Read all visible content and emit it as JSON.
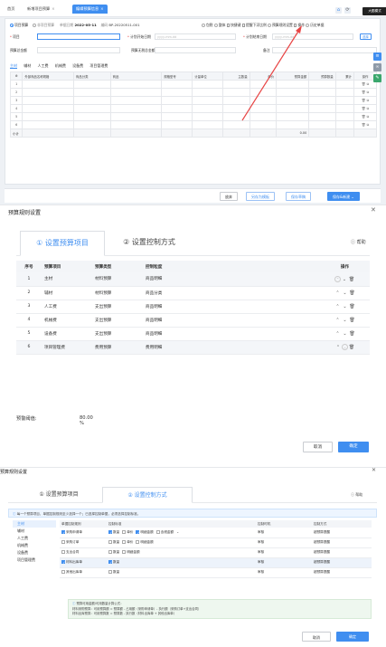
{
  "app": {
    "tabs": [
      {
        "label": "首页",
        "active": false
      },
      {
        "label": "新增项目预算",
        "active": false
      },
      {
        "label": "编辑预算信息",
        "active": true
      }
    ],
    "tooltip": "大图模式",
    "header": {
      "mode_project": "项目预算",
      "mode_nonproject": "非项目预算",
      "date_label": "单据日期",
      "date_value": "2022-05-11",
      "code_label": "编码",
      "code_value": "BP-20220511-001",
      "options": [
        "包税",
        "整体",
        "快捷键",
        "提醒下浮比例",
        "预算规则设置",
        "操作",
        "历史单据"
      ]
    },
    "form": {
      "project_label": "项目",
      "plan_start_label": "计划开始日期",
      "plan_start_placeholder": "yyyy-mm-dd",
      "plan_end_label": "计划结束日期",
      "plan_end_placeholder": "yyyy-mm-dd",
      "select_button": "选择",
      "budget_total_label": "预算总金额",
      "budget_excl_label": "预算无税总金额",
      "remark_label": "备注"
    },
    "subtabs": [
      "主材",
      "辅材",
      "人工费",
      "机械费",
      "设备费",
      "项目管理费"
    ],
    "grid": {
      "headers": [
        "",
        "外部商品名称规格",
        "商品分类",
        "商品",
        "规格型号",
        "计量单位",
        "主数量",
        "单价",
        "预算金额",
        "预算数量",
        "累计",
        "操作"
      ],
      "rows": [
        "1",
        "2",
        "3",
        "4",
        "5",
        "6"
      ],
      "sum_label": "小计",
      "sum_value": "0.00"
    },
    "footer": {
      "cancel": "放弃",
      "save_template": "另存为模板",
      "save_draft": "保存草稿",
      "save_add": "保存&新建"
    }
  },
  "dialog1": {
    "title": "预算规则设置",
    "step1": "① 设置预算项目",
    "step2": "② 设置控制方式",
    "help": "帮助",
    "headers": [
      "序号",
      "预算项目",
      "预算类型",
      "控制粒度",
      "操作"
    ],
    "rows": [
      {
        "no": "1",
        "item": "主材",
        "type": "材料预算",
        "granularity": "商品明细"
      },
      {
        "no": "2",
        "item": "辅材",
        "type": "材料预算",
        "granularity": "商品分类"
      },
      {
        "no": "3",
        "item": "人工费",
        "type": "支出预算",
        "granularity": "商品明细"
      },
      {
        "no": "4",
        "item": "机械费",
        "type": "支出预算",
        "granularity": "商品明细"
      },
      {
        "no": "5",
        "item": "设备费",
        "type": "支出预算",
        "granularity": "商品明细"
      },
      {
        "no": "6",
        "item": "项目管理费",
        "type": "费用预算",
        "granularity": "费用明细"
      }
    ],
    "threshold_label": "预警阈值:",
    "threshold_value": "80.00 %",
    "cancel": "取消",
    "ok": "确定"
  },
  "dialog2": {
    "title": "预算规则设置",
    "step1": "① 设置预算项目",
    "step2": "② 设置控制方式",
    "help": "帮助",
    "notice": "每一个预算项目，单据控制规则至少选择一个；已选择控制单据，必须选择控制标准。",
    "nav": [
      "主材",
      "辅材",
      "人工费",
      "机械费",
      "设备费",
      "项目管理费"
    ],
    "headers": [
      "单据控制规则",
      "控制标准",
      "控制时机",
      "控制方式"
    ],
    "rows": [
      {
        "doc": "采购申请单",
        "doc_on": true,
        "std": [
          [
            "数量",
            true
          ],
          [
            "单价",
            false
          ],
          [
            "明细金额",
            true
          ],
          [
            "含税金额",
            false
          ]
        ],
        "timing": "审核",
        "method": "超预算提醒"
      },
      {
        "doc": "采购订单",
        "doc_on": false,
        "std": [
          [
            "数量",
            false
          ],
          [
            "单价",
            false
          ],
          [
            "明细金额",
            false
          ]
        ],
        "timing": "审核",
        "method": "超预算提醒"
      },
      {
        "doc": "支出合同",
        "doc_on": false,
        "std": [
          [
            "数量",
            false
          ],
          [
            "明细金额",
            false
          ]
        ],
        "timing": "审核",
        "method": "超预算提醒"
      },
      {
        "doc": "材料出库单",
        "doc_on": true,
        "std": [
          [
            "数量",
            true
          ]
        ],
        "timing": "审核",
        "method": "超预算提醒"
      },
      {
        "doc": "其他出库单",
        "doc_on": false,
        "std": [
          [
            "数量",
            false
          ]
        ],
        "timing": "审核",
        "method": "超预算提醒"
      }
    ],
    "formula_lines": [
      "预算可用金额/可用数量计算公式：",
      "材料采购预算：可用预算额 = 预算额 - 占用额（采购申请单）- 执行额（采购订单+支出合同）",
      "材料出库预算：可用预算数 = 预算数 - 执行数（材料出库单 + 其他出库单）"
    ],
    "cancel": "取消",
    "ok": "确定"
  },
  "colors": {
    "accent": "#3f8ef0",
    "arrow": "#e84545"
  }
}
